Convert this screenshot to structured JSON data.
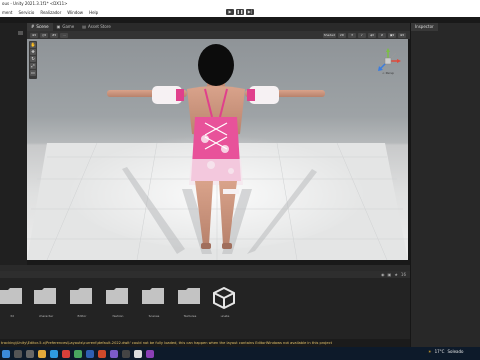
{
  "window": {
    "title": "ous - Unity 2021.3.1f1* <DX11>"
  },
  "menu": [
    "ment",
    "Servicio",
    "Realizador",
    "Window",
    "Help"
  ],
  "play_controls": {
    "play": "▶",
    "pause": "❚❚",
    "step": "▶|"
  },
  "scene_tabs": [
    {
      "label": "Scene",
      "icon": "grid-icon"
    },
    {
      "label": "Game",
      "icon": "game-icon"
    },
    {
      "label": "Asset Store",
      "icon": "store-icon"
    }
  ],
  "scene_toolbar": {
    "shading": "Shaded",
    "mode": "2D"
  },
  "gizmo": {
    "label": "< Persp"
  },
  "inspector": {
    "title": "Inspector"
  },
  "folders": [
    {
      "label": "3d"
    },
    {
      "label": "character"
    },
    {
      "label": "Editor"
    },
    {
      "label": "fashion"
    },
    {
      "label": "Scenes"
    },
    {
      "label": "Textures"
    },
    {
      "label": "unete"
    }
  ],
  "asset_bar": {
    "count": "16"
  },
  "status": {
    "message": "tracking\\Unity\\Editor-5.x\\Preferences\\Layouts\\current\\default-2022.dwlt' could not be fully loaded, this can happen when the layout contains EditorWindows not available in this project"
  },
  "taskbar": {
    "weather_temp": "17°C",
    "weather_text": "Soleado"
  },
  "colors": {
    "accent": "#e6c46a",
    "taskbar": "#0d1a2a"
  }
}
